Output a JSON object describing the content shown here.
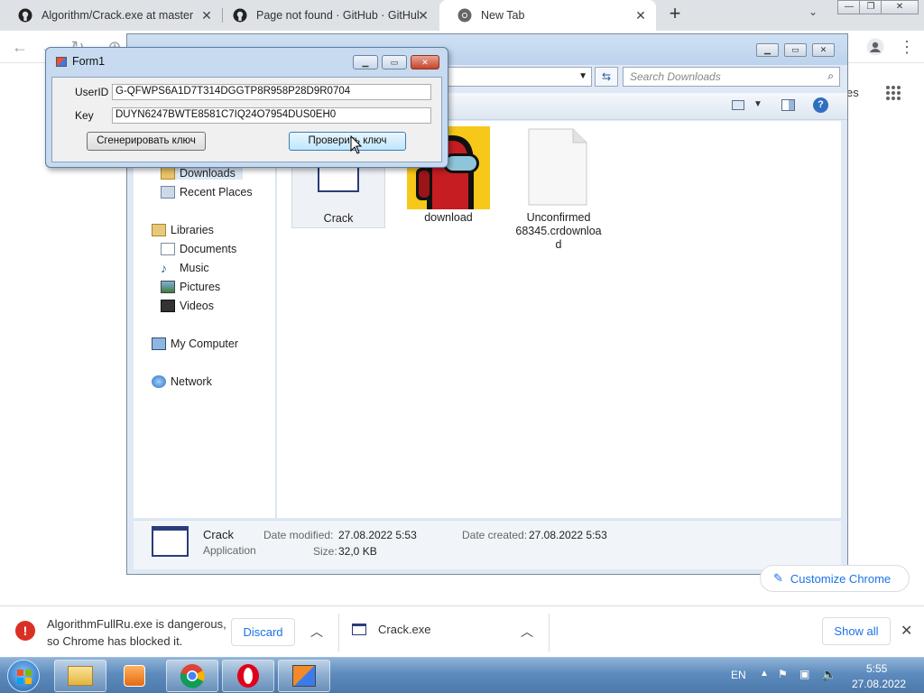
{
  "chrome": {
    "tabs": [
      {
        "title": "Algorithm/Crack.exe at master · A"
      },
      {
        "title": "Page not found · GitHub · GitHub"
      },
      {
        "title": "New Tab"
      }
    ],
    "new_tab_glyph": "+",
    "ntp_right_text": "es",
    "customize_label": "Customize Chrome"
  },
  "explorer": {
    "search_placeholder": "Search Downloads",
    "nav": {
      "downloads": "Downloads",
      "recent_places": "Recent Places",
      "libraries": "Libraries",
      "documents": "Documents",
      "music": "Music",
      "pictures": "Pictures",
      "videos": "Videos",
      "my_computer": "My Computer",
      "network": "Network"
    },
    "files": [
      {
        "name": "Crack"
      },
      {
        "name": "download"
      },
      {
        "name_lines": [
          "Unconfirmed",
          "68345.crdownloa",
          "d"
        ]
      }
    ],
    "details": {
      "name": "Crack",
      "type": "Application",
      "modified_label": "Date modified:",
      "modified_value": "27.08.2022 5:53",
      "size_label": "Size:",
      "size_value": "32,0 KB",
      "created_label": "Date created:",
      "created_value": "27.08.2022 5:53"
    }
  },
  "form1": {
    "title": "Form1",
    "userid_label": "UserID",
    "userid_value": "G-QFWPS6A1D7T314DGGTP8R958P28D9R0704",
    "key_label": "Key",
    "key_value": "DUYN6247BWTE8581C7IQ24O7954DUS0EH0",
    "generate_label": "Сгенерировать ключ",
    "check_label": "Проверить ключ"
  },
  "download_bar": {
    "warning_line1": "AlgorithmFullRu.exe is dangerous,",
    "warning_line2": "so Chrome has blocked it.",
    "discard_label": "Discard",
    "file_name": "Crack.exe",
    "show_all_label": "Show all"
  },
  "taskbar": {
    "lang": "EN",
    "time": "5:55",
    "date": "27.08.2022"
  },
  "colors": {
    "chrome_blue": "#1a73e8",
    "danger_red": "#d93025",
    "taskbar_blue": "#5d8bbd"
  }
}
